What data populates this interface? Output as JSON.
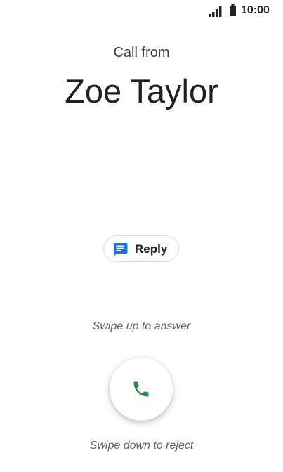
{
  "status_bar": {
    "time": "10:00",
    "signal_icon": "cell-signal-icon",
    "battery_icon": "battery-full-icon"
  },
  "call": {
    "header": "Call from",
    "caller_name": "Zoe Taylor"
  },
  "reply": {
    "label": "Reply",
    "icon": "message-icon",
    "icon_color": "#1a73e8"
  },
  "answer": {
    "hint_up": "Swipe up to answer",
    "hint_down": "Swipe down to reject",
    "icon": "phone-icon",
    "icon_color": "#1e8e3e"
  }
}
